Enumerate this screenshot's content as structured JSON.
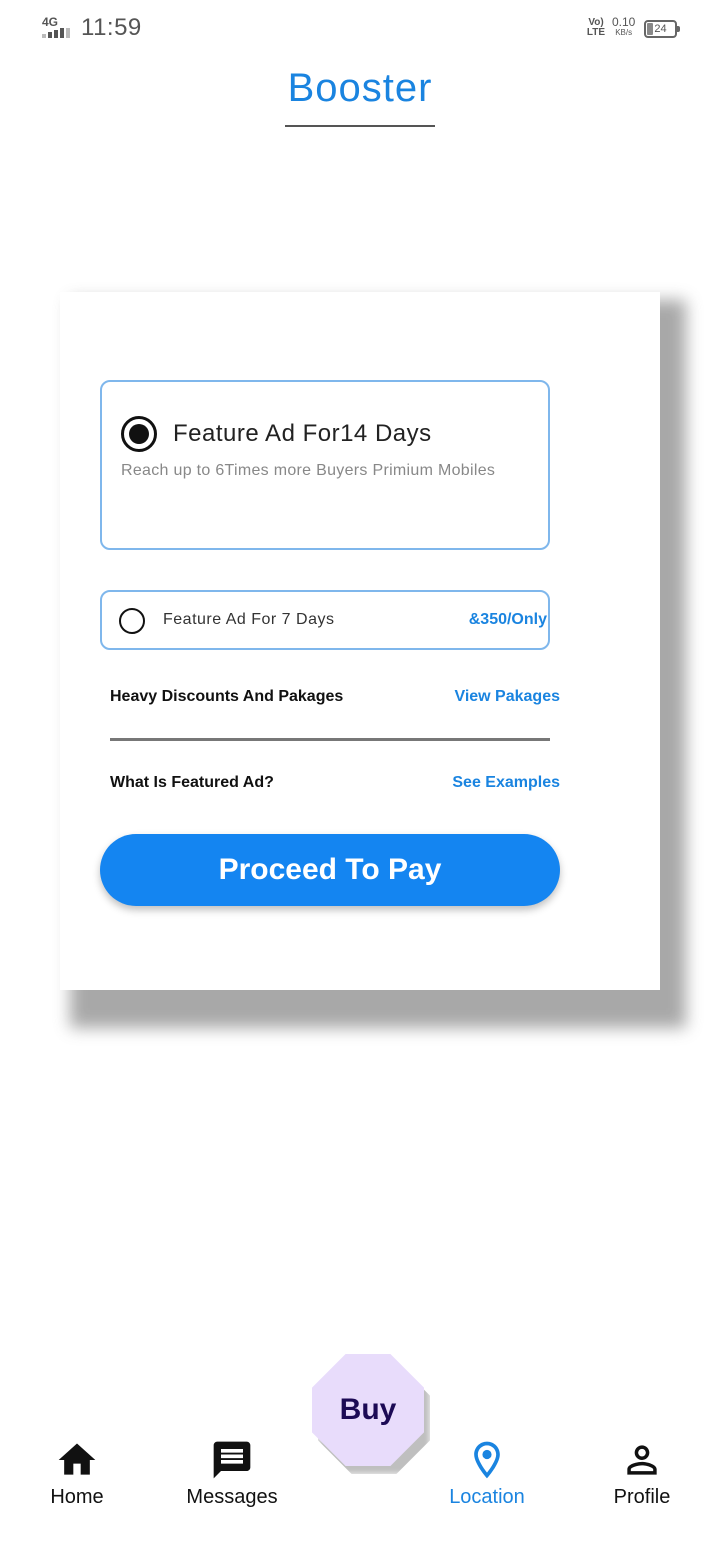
{
  "status_bar": {
    "network": "4G",
    "time": "11:59",
    "volte": "Vo) LTE",
    "speed": "0.10",
    "speed_unit": "KB/s",
    "battery": "24"
  },
  "header": {
    "title": "Booster"
  },
  "options": {
    "premium": {
      "title": "Feature Ad For14 Days",
      "subtitle": "Reach up to 6Times more Buyers Primium Mobiles",
      "selected": true
    },
    "basic": {
      "title": "Feature Ad For 7 Days",
      "price": "&350/Only",
      "selected": false
    }
  },
  "packages": {
    "label": "Heavy Discounts And Pakages",
    "link": "View Pakages"
  },
  "featured_info": {
    "label": "What Is Featured Ad?",
    "link": "See Examples"
  },
  "pay_button": {
    "label": "Proceed To Pay"
  },
  "fab": {
    "label": "Buy"
  },
  "nav": {
    "accent": "#1a84e0",
    "items": [
      {
        "label": "Home",
        "icon": "home-icon"
      },
      {
        "label": "Messages",
        "icon": "message-icon"
      },
      {
        "label": "Location",
        "icon": "location-pin-icon",
        "active": true
      },
      {
        "label": "Profile",
        "icon": "person-icon"
      }
    ]
  }
}
